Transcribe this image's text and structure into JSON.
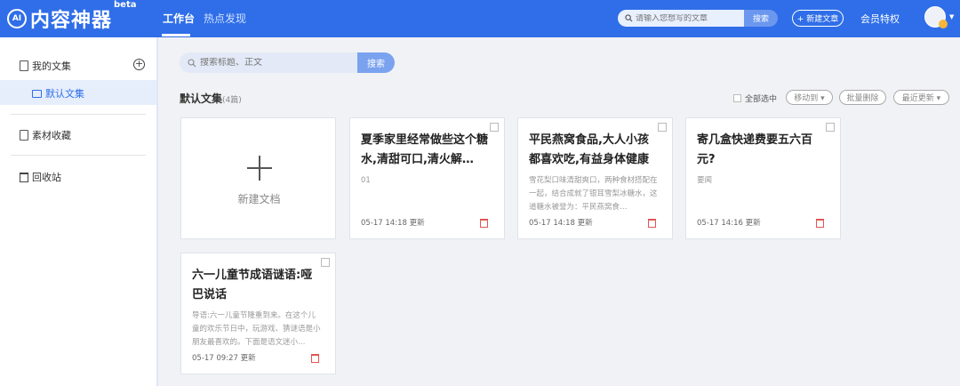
{
  "header": {
    "logo_mark": "AI",
    "logo_text": "内容神器",
    "logo_beta": "beta",
    "tabs": [
      {
        "label": "工作台",
        "active": true
      },
      {
        "label": "热点发现",
        "active": false
      }
    ],
    "search_placeholder": "请输入您想写的文章",
    "search_button": "搜索",
    "new_article": "+ 新建文章",
    "member": "会员特权",
    "brand_color": "#2f6ee8"
  },
  "sidebar": {
    "my_collections": "我的文集",
    "default_collection": "默认文集",
    "materials": "素材收藏",
    "recycle_bin": "回收站",
    "add_icon": "+"
  },
  "main": {
    "search_placeholder": "搜索标题、正文",
    "search_button": "搜索",
    "section_title": "默认文集",
    "section_count": "(4篇)",
    "select_all": "全部选中",
    "move_to": "移动到 ▾",
    "batch_delete": "批量删除",
    "recent_update": "最近更新 ▾",
    "new_doc": "新建文档",
    "cards": [
      {
        "title": "夏季家里经常做些这个糖水,清甜可口,清火解…",
        "desc": "01",
        "date": "05-17 14:18 更新"
      },
      {
        "title": "平民燕窝食品,大人小孩都喜欢吃,有益身体健康",
        "desc": "雪花梨口味清甜爽口，两种食材搭配在一起，结合成就了银耳雪梨冰糖水，这道糖水被誉为：平民燕窝食…",
        "date": "05-17 14:18 更新"
      },
      {
        "title": "寄几盒快递费要五六百元?",
        "desc": "要闻",
        "date": "05-17 14:16 更新"
      },
      {
        "title": "六一儿童节成语谜语:哑巴说话",
        "desc": "导语:六一儿童节隆重到来。在这个儿童的欢乐节日中，玩游戏、猜谜语是小朋友最喜欢的。下面是语文迷小…",
        "date": "05-17 09:27 更新"
      }
    ]
  }
}
